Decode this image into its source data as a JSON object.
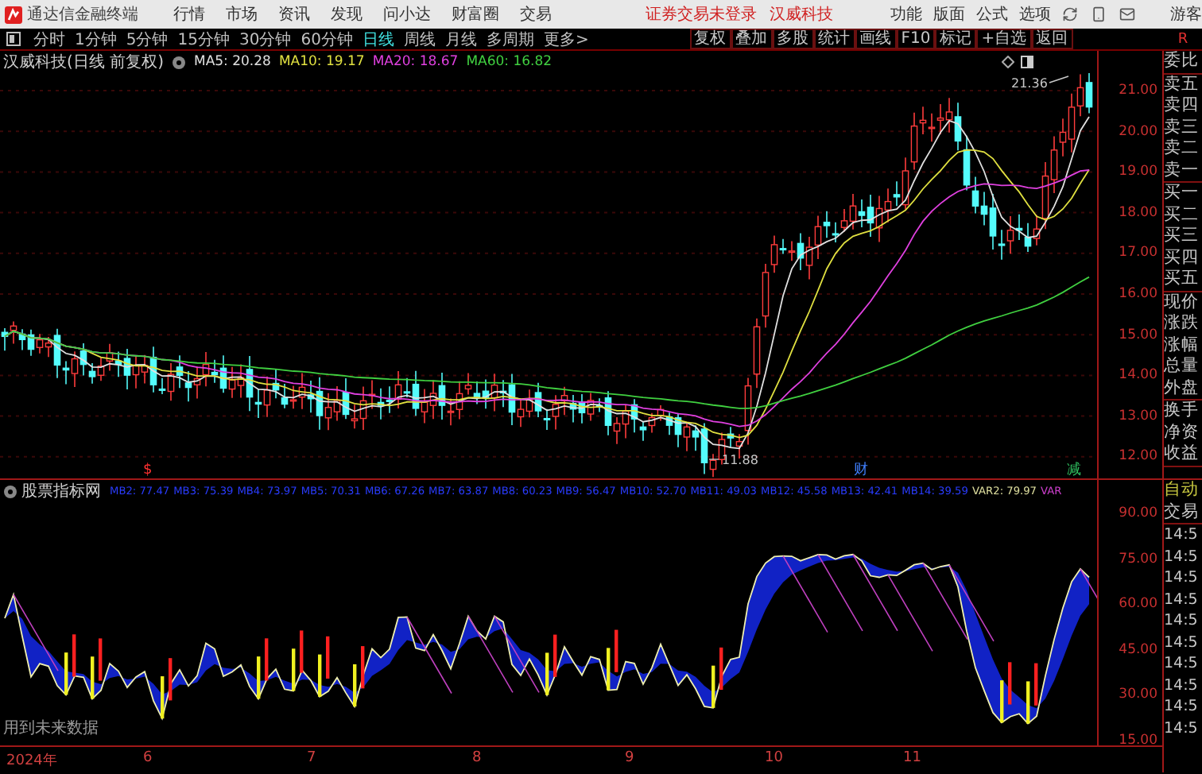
{
  "menubar": {
    "app_title": "通达信金融终端",
    "menus": [
      "行情",
      "市场",
      "资讯",
      "发现",
      "问小达",
      "财富圈",
      "交易"
    ],
    "notice": "证券交易未登录",
    "stock": "汉威科技",
    "right_menus": [
      "功能",
      "版面",
      "公式",
      "选项"
    ],
    "user": "游客"
  },
  "periods": [
    {
      "label": "分时",
      "selected": false
    },
    {
      "label": "1分钟",
      "selected": false
    },
    {
      "label": "5分钟",
      "selected": false
    },
    {
      "label": "15分钟",
      "selected": false
    },
    {
      "label": "30分钟",
      "selected": false
    },
    {
      "label": "60分钟",
      "selected": false
    },
    {
      "label": "日线",
      "selected": true
    },
    {
      "label": "周线",
      "selected": false
    },
    {
      "label": "月线",
      "selected": false
    },
    {
      "label": "多周期",
      "selected": false
    },
    {
      "label": "更多>",
      "selected": false
    }
  ],
  "tools": [
    "复权",
    "叠加",
    "多股",
    "统计",
    "画线",
    "F10",
    "标记",
    "+自选",
    "返回"
  ],
  "side_tab": "R",
  "main_chart": {
    "title": "汉威科技(日线 前复权)",
    "mas": [
      {
        "label": "MA5: 20.28",
        "color": "#e0e0e0"
      },
      {
        "label": "MA10: 19.17",
        "color": "#e0e040"
      },
      {
        "label": "MA20: 18.67",
        "color": "#e040e0"
      },
      {
        "label": "MA60: 16.82",
        "color": "#40d040"
      }
    ],
    "high_label": "21.36",
    "low_label": "11.88",
    "events": [
      {
        "label": "$",
        "color": "#ff3030"
      },
      {
        "label": "财",
        "color": "#4080ff"
      },
      {
        "label": "减",
        "color": "#30c060"
      }
    ],
    "yticks": [
      "21.00",
      "20.00",
      "19.00",
      "18.00",
      "17.00",
      "16.00",
      "15.00",
      "14.00",
      "13.00",
      "12.00"
    ]
  },
  "indicator": {
    "name": "股票指标网",
    "values": [
      {
        "label": "MB2: 77.47",
        "color": "#2a3cff"
      },
      {
        "label": "MB3: 75.39",
        "color": "#2a3cff"
      },
      {
        "label": "MB4: 73.97",
        "color": "#2a3cff"
      },
      {
        "label": "MB5: 70.31",
        "color": "#2a3cff"
      },
      {
        "label": "MB6: 67.26",
        "color": "#2a3cff"
      },
      {
        "label": "MB7: 63.87",
        "color": "#2a3cff"
      },
      {
        "label": "MB8: 60.23",
        "color": "#2a3cff"
      },
      {
        "label": "MB9: 56.47",
        "color": "#2a3cff"
      },
      {
        "label": "MB10: 52.70",
        "color": "#2a3cff"
      },
      {
        "label": "MB11: 49.03",
        "color": "#2a3cff"
      },
      {
        "label": "MB12: 45.58",
        "color": "#2a3cff"
      },
      {
        "label": "MB13: 42.41",
        "color": "#2a3cff"
      },
      {
        "label": "MB14: 39.59",
        "color": "#2a3cff"
      },
      {
        "label": "VAR2: 79.97",
        "color": "#e0e0a0"
      },
      {
        "label": "VAR",
        "color": "#d040d0"
      }
    ],
    "note": "用到未来数据",
    "yticks": [
      "90.00",
      "75.00",
      "60.00",
      "45.00",
      "30.00",
      "15.00"
    ]
  },
  "date_axis": [
    "2024年",
    "6",
    "7",
    "8",
    "9",
    "10",
    "11"
  ],
  "quote_panel": {
    "groups": [
      [
        "委比"
      ],
      [
        "卖五",
        "卖四",
        "卖三",
        "卖二",
        "卖一"
      ],
      [
        "买一",
        "买二",
        "买三",
        "买四",
        "买五"
      ],
      [
        "现价",
        "涨跌",
        "涨幅",
        "总量",
        "外盘"
      ],
      [
        "换手",
        "净资",
        "收益"
      ]
    ],
    "auto": "自动",
    "trade": "交易",
    "times": [
      "14:5",
      "14:5",
      "14:5",
      "14:5",
      "14:5",
      "14:5",
      "14:5",
      "14:5",
      "14:5",
      "14:5"
    ]
  }
}
